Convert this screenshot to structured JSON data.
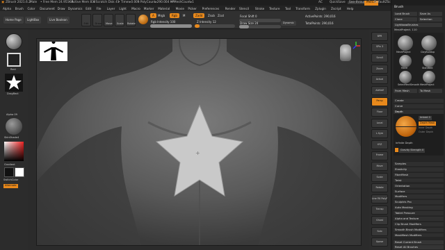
{
  "title_bar": {
    "app": "ZBrush 2021.6.2",
    "project": "Male",
    "stats": [
      "• Free Mem 24.951GB",
      "• Active Mem 832",
      "• Scratch Disk 41",
      "• Timer▸0.005",
      "• PolyCount▸290.004 KP",
      "• MeshCount▸1"
    ],
    "ac": "AC",
    "quicksave": "QuickSave",
    "seethrough": "See-through 0",
    "menus": "Menus",
    "defaultscript": "DefaultZScript"
  },
  "menubar": [
    "Alpha",
    "Brush",
    "Color",
    "Document",
    "Draw",
    "Dynamics",
    "Edit",
    "File",
    "Layer",
    "Light",
    "Macro",
    "Marker",
    "Material",
    "Movie",
    "Picker",
    "Preferences",
    "Render",
    "Stencil",
    "Stroke",
    "Texture",
    "Tool",
    "Transform",
    "Zplugin",
    "Zscript",
    "Help"
  ],
  "toolbar": {
    "home": "Home Page",
    "lightbox": "LightBox",
    "livebool": "Live Boolean",
    "edit": "Edit",
    "draw": "Draw",
    "move": "Move",
    "scale": "Scale",
    "rotate": "Rotate",
    "a_label": "A",
    "mrgb": "Mrgb",
    "rgb": "Rgb",
    "m": "M",
    "zadd": "Zadd",
    "zsub": "Zsub",
    "zcut": "Zcut",
    "rgb_intensity": "Rgb Intensity 100",
    "z_intensity": "Z Intensity 12",
    "focal_shift": "Focal Shift 0",
    "draw_size": "Draw Size 24",
    "dynamic": "Dynamic",
    "active_points": "ActivePoints: 290,016",
    "total_points": "TotalPoints: 290,016",
    "rgb_intensity_value": 1.0,
    "z_intensity_value": 0.12,
    "draw_size_value": 0.24
  },
  "left_shelf": {
    "brush_label": "",
    "rect_label": "Rect",
    "stroke_label": "DragRect",
    "alpha_label": "Alpha 09",
    "material_label": "SkinShade4",
    "texture_label": "Texture Off",
    "gradient": "Gradient",
    "switch_color": "SwitchColor",
    "alternate": "Alternate"
  },
  "right_shelf": [
    "BPR",
    "SPix 3",
    "Scroll",
    "Zoom",
    "Actual",
    "AAHalf",
    "Persp",
    "Floor",
    "Local",
    "L.Sym",
    "XYZ",
    "Frame",
    "Move",
    "Scale",
    "Rotate",
    "Line Fill PolyF",
    "Transp",
    "Ghost",
    "Solo",
    "Xpose"
  ],
  "palette": {
    "title": "Brush",
    "row1": [
      "Load Brush",
      "Save As"
    ],
    "row2": [
      "Clone",
      "Selection"
    ],
    "lightbox_brushes": "Lightbox▸Brushes",
    "current_brush": "MeshProject. 110",
    "brushes": [
      "MeshProject",
      "ClayBuildup",
      "Move",
      "Standard",
      "SelectRect",
      "MeshProject",
      "Smooth"
    ],
    "buttons": [
      "From Mesh",
      "To Mesh"
    ],
    "sections": [
      "Create",
      "Curve",
      "Depth"
    ],
    "depth": {
      "imbed": "Imbed 0",
      "depth_mask": "Depth Mask",
      "inner_depth": "Inner Depth",
      "outer_depth": "Outer Depth",
      "infinite_depth": "Infinite Depth",
      "gravity": "Gravity Strength 0"
    },
    "menu_items": [
      "Samples",
      "Elasticity",
      "FiberMesh",
      "Twist",
      "Orientation",
      "Surface",
      "Modifiers",
      "Sculptris Pro",
      "Auto Masking",
      "Tablet Pressure",
      "Alpha and Texture",
      "Clip Brush Modifiers",
      "Smooth Brush Modifiers",
      "MaskMesh Modifiers"
    ],
    "reset_current": "Reset Current Brush",
    "reset_all": "Reset All Brushes"
  },
  "colors": {
    "accent": "#e8891c",
    "panel": "#262626",
    "canvas": "#3c3c3c",
    "skin": "#6b6b6b"
  },
  "icons": [
    "zbrush-logo-icon",
    "pose-figure-icon",
    "rect-stroke-icon",
    "star-alpha-icon",
    "material-sphere-icon",
    "color-picker-icon",
    "head-navigator-icon",
    "axis-gizmo-icon",
    "brush-sphere-icon"
  ]
}
